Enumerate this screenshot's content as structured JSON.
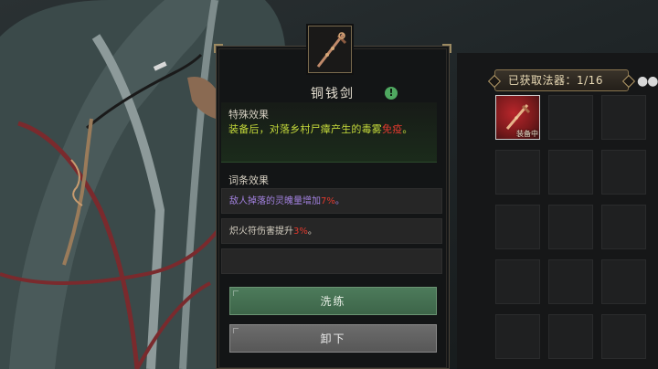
{
  "item": {
    "name": "铜钱剑",
    "info_icon": "info-icon",
    "icon": "coin-sword-icon"
  },
  "special": {
    "title": "特殊效果",
    "text_prefix": "装备后，对落乡村尸瘴产生的毒雾",
    "text_highlight": "免疫",
    "text_suffix": "。"
  },
  "affixes": {
    "title": "词条效果",
    "rows": [
      {
        "prefix": "敌人掉落的灵魄量增加",
        "value": "7%",
        "suffix": "。"
      },
      {
        "prefix": "炽火符伤害提升",
        "value": "3%",
        "suffix": "。"
      },
      {
        "prefix": "",
        "value": "",
        "suffix": ""
      }
    ]
  },
  "buttons": {
    "wash": "洗练",
    "unload": "卸下"
  },
  "inventory": {
    "count_label": "已获取法器：1/16",
    "more_icon": "more-dots-icon",
    "equipped_tag": "装备中",
    "slots_total": 15,
    "slots_filled": 1
  },
  "colors": {
    "special_text": "#c4d93a",
    "highlight_red": "#e0392e",
    "affix_purple": "#a382e0",
    "wash_button": "#4d7b5b",
    "unload_button": "#6c6c6c"
  }
}
